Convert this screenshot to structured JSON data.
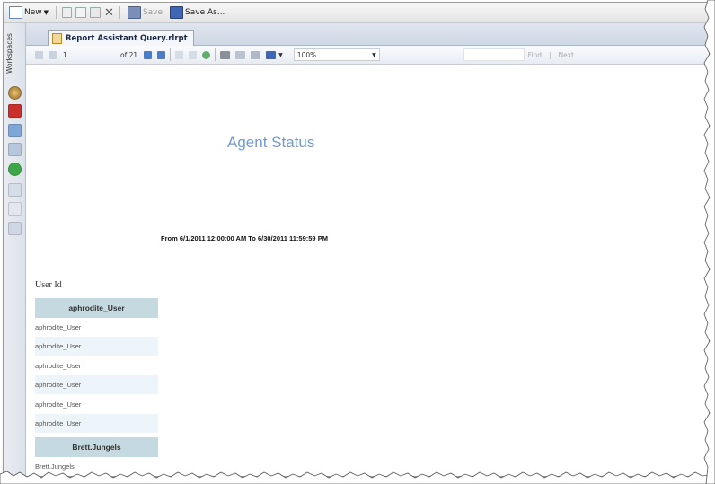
{
  "toolbar": {
    "new_label": "New",
    "save_label": "Save",
    "save_as_label": "Save As..."
  },
  "workspace": {
    "label": "Workspaces"
  },
  "tab": {
    "title": "Report Assistant Query.rlrpt"
  },
  "viewer": {
    "page_current": "1",
    "page_total": "of 21",
    "zoom": "100%",
    "find_label": "Find",
    "next_label": "Next"
  },
  "report": {
    "title": "Agent Status",
    "date_range": "From 6/1/2011 12:00:00 AM  To 6/30/2011 11:59:59 PM",
    "user_id_label": "User Id",
    "groups": [
      {
        "name": "aphrodite_User",
        "rows": [
          "aphrodite_User",
          "aphrodite_User",
          "aphrodite_User",
          "aphrodite_User",
          "aphrodite_User",
          "aphrodite_User"
        ]
      },
      {
        "name": "Brett.Jungels",
        "rows": [
          "Brett.Jungels"
        ]
      }
    ]
  },
  "colors": {
    "title_blue": "#6f9bd0",
    "group_header": "#c4d9e0",
    "row_alt": "#eef5fa"
  },
  "icons": [
    "new-icon",
    "cut-icon",
    "copy-icon",
    "paste-icon",
    "delete-icon",
    "save-icon",
    "save-as-icon",
    "first-page-icon",
    "prev-page-icon",
    "next-page-icon",
    "last-page-icon",
    "stop-icon",
    "refresh-icon",
    "back-icon",
    "print-icon",
    "print-layout-icon",
    "page-setup-icon",
    "export-icon"
  ]
}
